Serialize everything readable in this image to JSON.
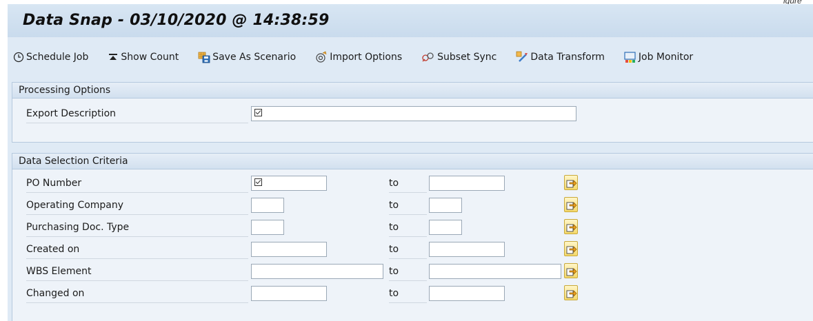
{
  "corner_text": "igure",
  "title": "Data Snap - 03/10/2020 @ 14:38:59",
  "toolbar": {
    "schedule_job": "Schedule Job",
    "show_count": "Show Count",
    "save_as_scenario": "Save As Scenario",
    "import_options": "Import Options",
    "subset_sync": "Subset Sync",
    "data_transform": "Data Transform",
    "job_monitor": "Job Monitor"
  },
  "processing": {
    "header": "Processing Options",
    "export_description_label": "Export Description",
    "export_description_value": ""
  },
  "selection": {
    "header": "Data Selection Criteria",
    "to_label": "to",
    "rows": [
      {
        "label": "PO Number",
        "from": "",
        "to": ""
      },
      {
        "label": "Operating Company",
        "from": "",
        "to": ""
      },
      {
        "label": "Purchasing Doc. Type",
        "from": "",
        "to": ""
      },
      {
        "label": "Created on",
        "from": "",
        "to": ""
      },
      {
        "label": "WBS Element",
        "from": "",
        "to": ""
      },
      {
        "label": "Changed on",
        "from": "",
        "to": ""
      }
    ]
  },
  "colors": {
    "frame_bg": "#dfeaf5",
    "panel_bg": "#eef3f9",
    "button_yellow": "#f5d96b"
  }
}
